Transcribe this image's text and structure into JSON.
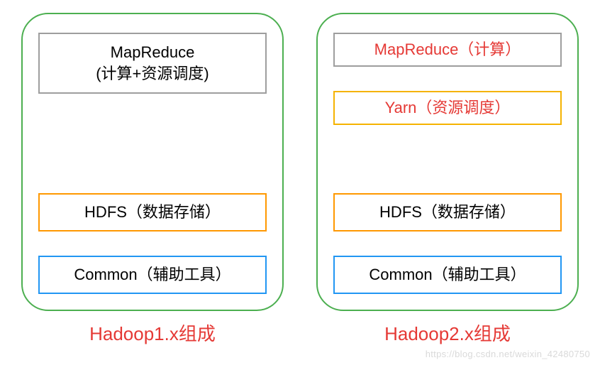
{
  "left": {
    "caption": "Hadoop1.x组成",
    "blocks": {
      "mapreduce_line1": "MapReduce",
      "mapreduce_line2": "(计算+资源调度)",
      "hdfs": "HDFS（数据存储）",
      "common": "Common（辅助工具）"
    }
  },
  "right": {
    "caption": "Hadoop2.x组成",
    "blocks": {
      "mapreduce": "MapReduce（计算）",
      "yarn": "Yarn（资源调度）",
      "hdfs": "HDFS（数据存储）",
      "common": "Common（辅助工具）"
    }
  },
  "watermark": "https://blog.csdn.net/weixin_42480750",
  "colors": {
    "panel_border": "#4caf50",
    "gray": "#9e9e9e",
    "orange": "#ff9800",
    "yellow": "#f5b301",
    "blue": "#2196f3",
    "red": "#e53935"
  }
}
